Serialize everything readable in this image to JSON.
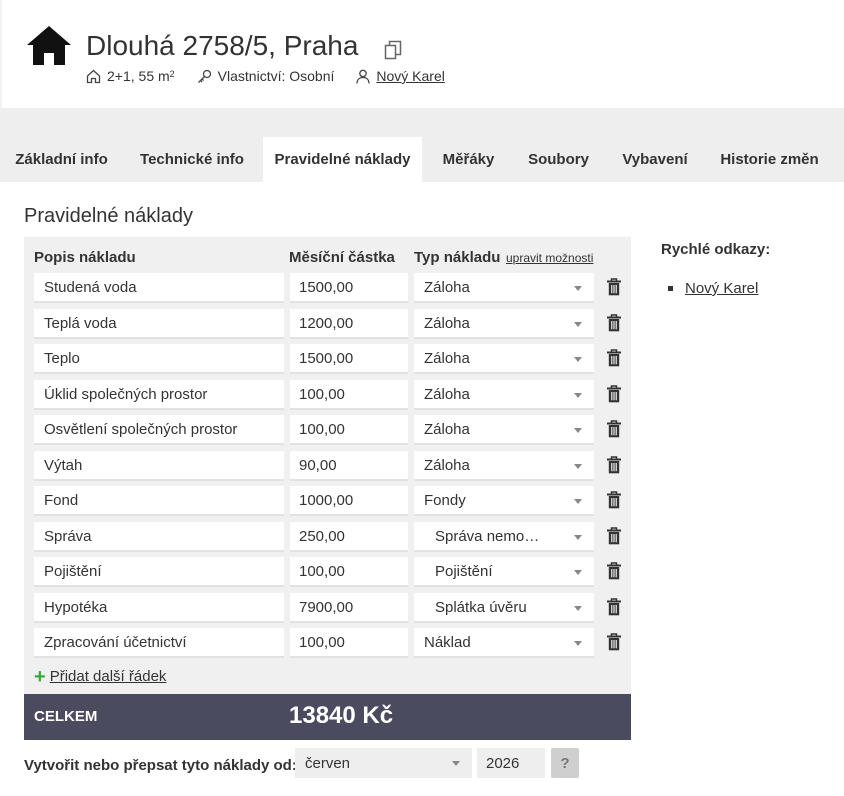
{
  "header": {
    "title": "Dlouhá 2758/5, Praha",
    "layout_text": "2+1, 55 m",
    "layout_sup": "2",
    "ownership": "Vlastnictví: Osobní",
    "owner_name": "Nový Karel"
  },
  "tabs": [
    {
      "label": "Základní info",
      "active": false
    },
    {
      "label": "Technické info",
      "active": false
    },
    {
      "label": "Pravidelné náklady",
      "active": true
    },
    {
      "label": "Měřáky",
      "active": false
    },
    {
      "label": "Soubory",
      "active": false
    },
    {
      "label": "Vybavení",
      "active": false
    },
    {
      "label": "Historie změn",
      "active": false
    }
  ],
  "section": {
    "title": "Pravidelné náklady"
  },
  "table": {
    "headers": {
      "description": "Popis nákladu",
      "amount": "Měsíční částka",
      "type": "Typ nákladu",
      "edit_options": "upravit možnosti"
    },
    "rows": [
      {
        "description": "Studená voda",
        "amount": "1500,00",
        "type": "Záloha"
      },
      {
        "description": "Teplá voda",
        "amount": "1200,00",
        "type": "Záloha"
      },
      {
        "description": "Teplo",
        "amount": "1500,00",
        "type": "Záloha"
      },
      {
        "description": "Úklid společných prostor",
        "amount": "100,00",
        "type": "Záloha"
      },
      {
        "description": "Osvětlení společných prostor",
        "amount": "100,00",
        "type": "Záloha"
      },
      {
        "description": "Výtah",
        "amount": "90,00",
        "type": "Záloha"
      },
      {
        "description": "Fond",
        "amount": "1000,00",
        "type": "Fondy"
      },
      {
        "description": "Správa",
        "amount": "250,00",
        "type": "Správa nemo…"
      },
      {
        "description": "Pojištění",
        "amount": "100,00",
        "type": "Pojištění"
      },
      {
        "description": "Hypotéka",
        "amount": "7900,00",
        "type": "Splátka úvěru"
      },
      {
        "description": "Zpracování účetnictví",
        "amount": "100,00",
        "type": "Náklad"
      }
    ],
    "add_row_label": "Přidat další řádek"
  },
  "total": {
    "label": "CELKEM",
    "value": "13840 Kč"
  },
  "sidebar": {
    "title": "Rychlé odkazy:",
    "links": [
      {
        "label": "Nový Karel"
      }
    ]
  },
  "footer": {
    "label": "Vytvořit nebo přepsat tyto náklady od:",
    "month": "červen",
    "year": "2026",
    "help": "?"
  },
  "colors": {
    "total_bar": "#4a4b5e",
    "add_icon": "#3ca83c",
    "panel_bg": "#f0f0f0",
    "tabbar_bg": "#eeeeee"
  }
}
